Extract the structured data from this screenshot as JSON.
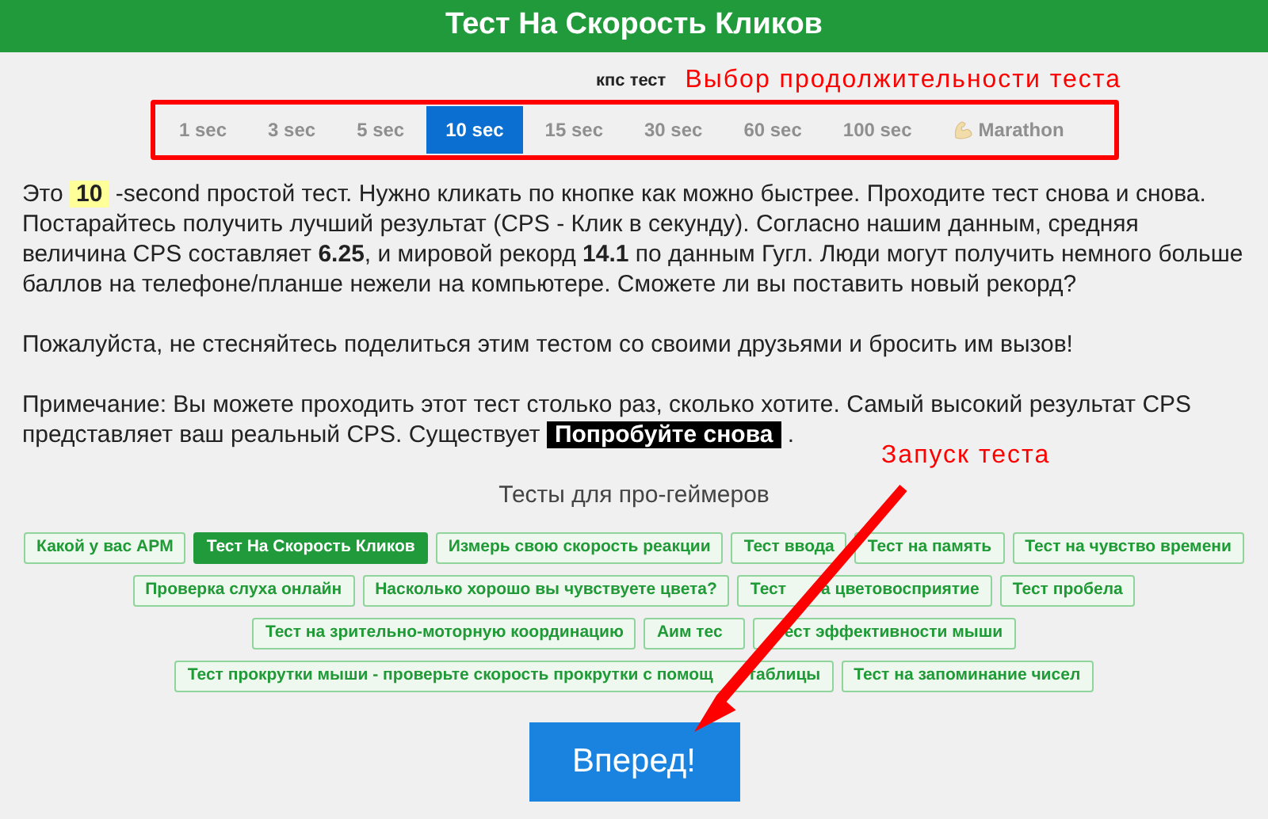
{
  "header": {
    "title": "Тест На Скорость Кликов"
  },
  "durations": {
    "label": "кпс тест",
    "annotation": "Выбор продолжительности теста",
    "options": [
      {
        "label": "1 sec",
        "selected": false,
        "kind": "time"
      },
      {
        "label": "3 sec",
        "selected": false,
        "kind": "time"
      },
      {
        "label": "5 sec",
        "selected": false,
        "kind": "time"
      },
      {
        "label": "10 sec",
        "selected": true,
        "kind": "time"
      },
      {
        "label": "15 sec",
        "selected": false,
        "kind": "time"
      },
      {
        "label": "30 sec",
        "selected": false,
        "kind": "time"
      },
      {
        "label": "60 sec",
        "selected": false,
        "kind": "time"
      },
      {
        "label": "100 sec",
        "selected": false,
        "kind": "time"
      },
      {
        "label": "Marathon",
        "selected": false,
        "kind": "marathon"
      }
    ]
  },
  "intro": {
    "seconds": "10",
    "text": "-second простой тест. Нужно кликать по кнопке как можно быстрее. Проходите тест снова и снова. Постарайтесь получить лучший результат (CPS - Клик в секунду). Согласно нашим данным, средняя величина CPS составляет **6.25**, и мировой рекорд **14.1** по данным Гугл. Люди могут получить немного больше баллов на телефоне/планше нежели на компьютере. Сможете ли вы поставить новый рекорд?",
    "prefix": "Это"
  },
  "share": "Пожалуйста, не стесняйтесь поделиться этим тестом со своими друзьями и бросить им вызов!",
  "note": {
    "text": "Примечание: Вы можете проходить этот тест столько раз, сколько хотите. Самый высокий результат CPS представляет ваш реальный CPS. Существует",
    "link": "Попробуйте снова",
    "suffix": "."
  },
  "annotation_start": "Запуск теста",
  "pro_tests": {
    "title": "Тесты для про-геймеров",
    "links": [
      {
        "parts": [
          "Какой у вас APM"
        ],
        "selected": false
      },
      {
        "parts": [
          "Тест На Скорость Кликов"
        ],
        "selected": true
      },
      {
        "parts": [
          "Измерь свою скорость реакции"
        ],
        "selected": false
      },
      {
        "parts": [
          "Тест ввода"
        ],
        "selected": false
      },
      {
        "parts": [
          "Тест на память"
        ],
        "selected": false
      },
      {
        "parts": [
          "Тест на чувство времени"
        ],
        "selected": false
      },
      {
        "parts": [
          "Проверка слуха онлайн"
        ],
        "selected": false
      },
      {
        "parts": [
          "Насколько хорошо вы чувствуете цвета?"
        ],
        "selected": false
      },
      {
        "parts": [
          "Тест",
          "а цветовосприятие"
        ],
        "selected": false
      },
      {
        "parts": [
          "Тест пробела"
        ],
        "selected": false
      },
      {
        "parts": [
          "Тест на зрительно-моторную координацию"
        ],
        "selected": false
      },
      {
        "parts": [
          "Аим тес"
        ],
        "gap_after": true,
        "selected": false
      },
      {
        "parts": [
          "ест эффективности мыши"
        ],
        "gap_before": true,
        "selected": false
      },
      {
        "parts": [
          "Тест прокрутки мыши - проверьте скорость прокрутки с помощ",
          "таблицы"
        ],
        "selected": false
      },
      {
        "parts": [
          "Тест на запоминание чисел"
        ],
        "selected": false
      }
    ]
  },
  "start_button": "Вперед!"
}
